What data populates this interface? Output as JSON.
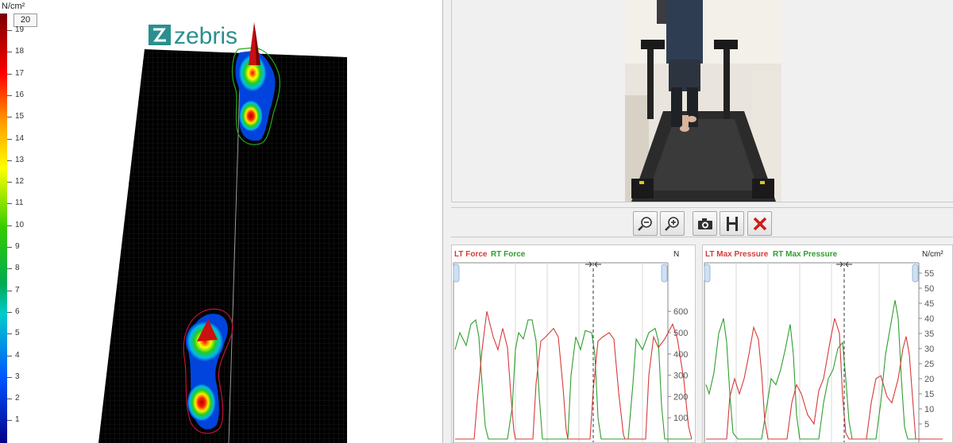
{
  "scale": {
    "unit": "N/cm²",
    "max_value": "20",
    "labels": [
      "19",
      "18",
      "17",
      "16",
      "15",
      "14",
      "13",
      "12",
      "11",
      "10",
      "9",
      "8",
      "7",
      "6",
      "5",
      "4",
      "3",
      "2",
      "1"
    ]
  },
  "brand": {
    "logo_text": "zebris",
    "logo_color": "#2a8f8f"
  },
  "toolbar": {
    "buttons": [
      {
        "name": "zoom-out",
        "icon": "zoom-out-icon"
      },
      {
        "name": "zoom-in",
        "icon": "zoom-in-icon"
      },
      {
        "name": "snapshot",
        "icon": "camera-icon"
      },
      {
        "name": "film",
        "icon": "film-strip-icon"
      },
      {
        "name": "close",
        "icon": "red-x-icon"
      }
    ]
  },
  "force_chart": {
    "legend_lt": "LT Force",
    "legend_rt": "RT Force",
    "unit": "N",
    "ticks": [
      "100",
      "200",
      "300",
      "400",
      "500",
      "600"
    ]
  },
  "pressure_chart": {
    "legend_lt": "LT Max Pressure",
    "legend_rt": "RT Max Pressure",
    "unit": "N/cm²",
    "ticks": [
      "5",
      "10",
      "15",
      "20",
      "25",
      "30",
      "35",
      "40",
      "45",
      "50",
      "55"
    ]
  },
  "colors": {
    "left": "#d63a3a",
    "right": "#2f9e2f"
  }
}
